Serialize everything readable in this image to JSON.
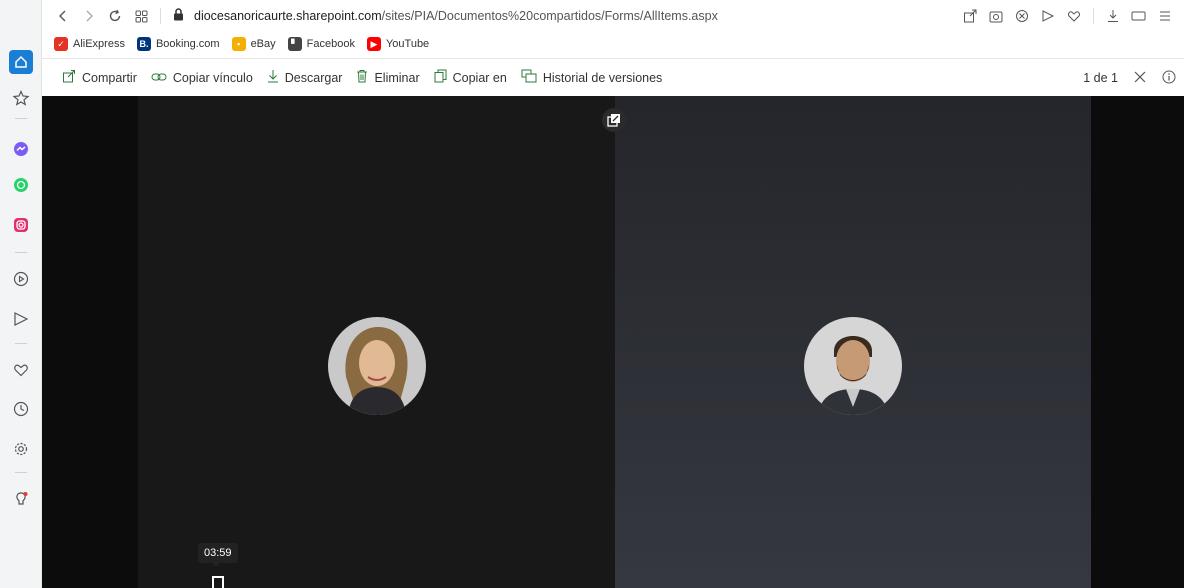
{
  "browser": {
    "url_host": "diocesanoricaurte.sharepoint.com",
    "url_path": "/sites/PIA/Documentos%20compartidos/Forms/AllItems.aspx",
    "bookmarks": [
      {
        "label": "AliExpress",
        "color": "#e43225"
      },
      {
        "label": "Booking.com",
        "color": "#003580"
      },
      {
        "label": "eBay",
        "color": "#f5af02"
      },
      {
        "label": "Facebook",
        "color": "#444444"
      },
      {
        "label": "YouTube",
        "color": "#ff0000"
      }
    ]
  },
  "toolbar": {
    "share": "Compartir",
    "copy_link": "Copiar vínculo",
    "download": "Descargar",
    "delete": "Eliminar",
    "copy_to": "Copiar en",
    "version_history": "Historial de versiones",
    "page_count": "1 de 1"
  },
  "video": {
    "timestamp": "03:59"
  },
  "colors": {
    "accent": "#0078d4",
    "toolbar_icon": "#2b7a3b"
  }
}
